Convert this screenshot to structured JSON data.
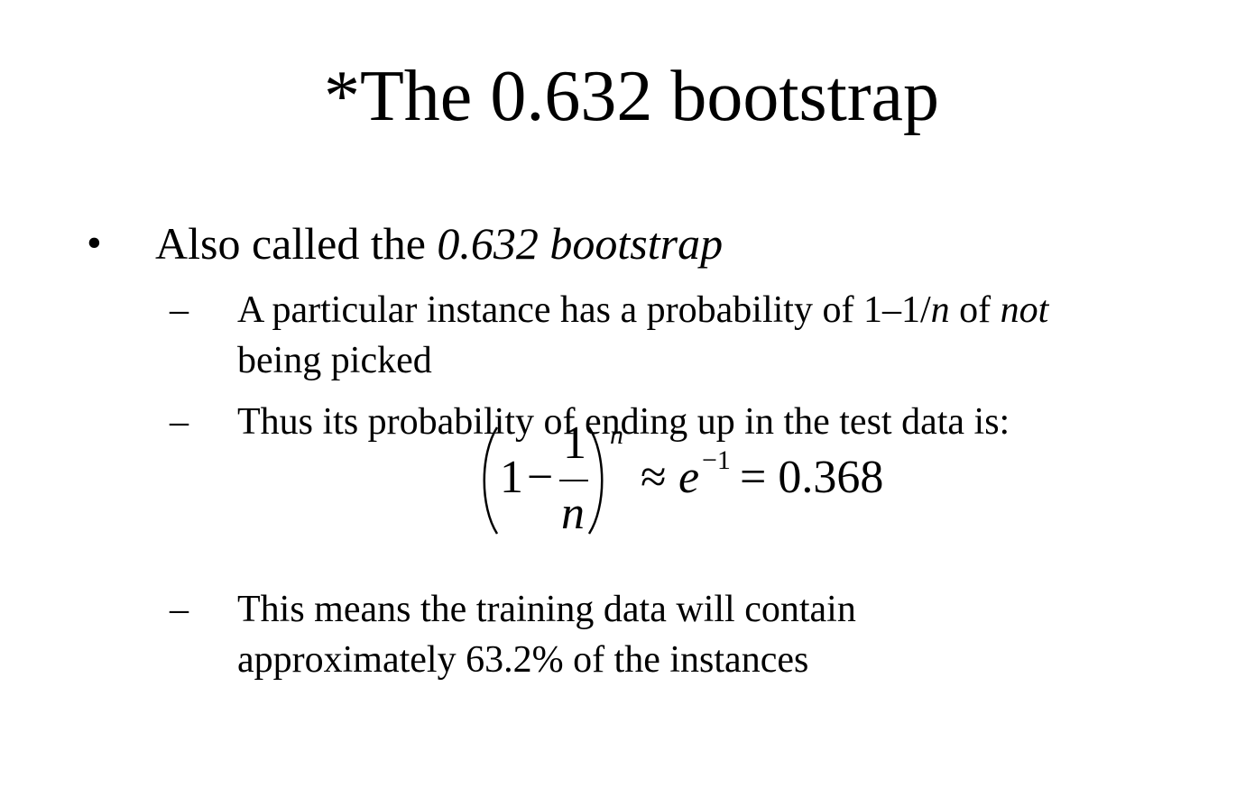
{
  "slide": {
    "title": "*The 0.632 bootstrap",
    "bullet": {
      "marker": "•",
      "text_plain": "Also called the ",
      "text_italic": "0.632 bootstrap"
    },
    "subbullets": [
      {
        "marker": "–",
        "line1_a": "A particular instance has a probability of 1–1/",
        "line1_n": "n",
        "line1_b": " of ",
        "line1_not": "not",
        "line2": "being picked"
      },
      {
        "marker": "–",
        "text": "Thus its probability of ending up in the test data is:"
      },
      {
        "marker": "–",
        "line1": "This means the training data will contain",
        "line2": "approximately 63.2% of the instances"
      }
    ],
    "formula": {
      "one": "1",
      "minus": "−",
      "numerator": "1",
      "denominator": "n",
      "exponent_n": "n",
      "approx": "≈",
      "e": "e",
      "e_exponent": "−1",
      "equals_value": "= 0.368"
    }
  }
}
